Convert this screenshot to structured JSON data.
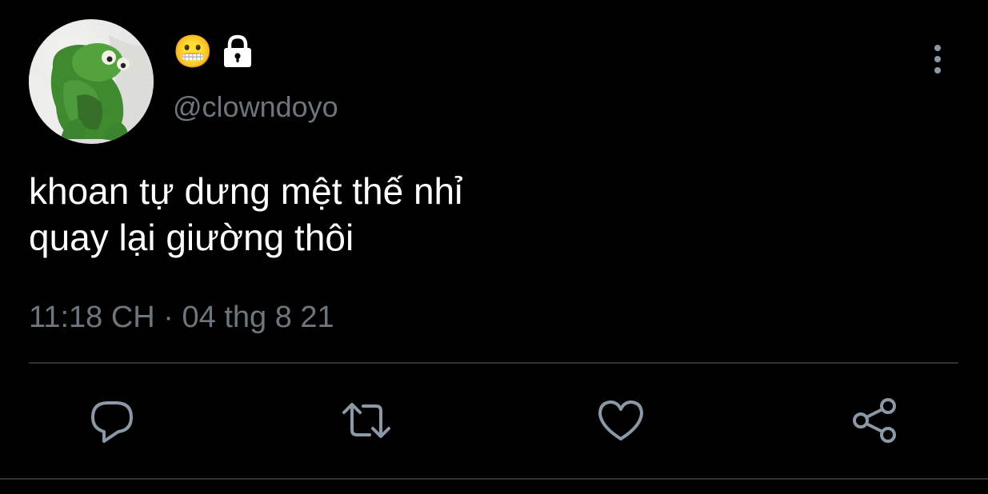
{
  "author": {
    "display_name": "😬",
    "handle": "@clowndoyo",
    "protected_icon": "lock-icon",
    "avatar": "kermit-avatar"
  },
  "tweet": {
    "lines": [
      "khoan tự dưng mệt thế nhỉ",
      "quay lại giường thôi"
    ],
    "time": "11:18 CH",
    "separator": "·",
    "date": "04 thg 8 21"
  },
  "actions": [
    {
      "icon": "reply-icon"
    },
    {
      "icon": "retweet-icon"
    },
    {
      "icon": "like-icon"
    },
    {
      "icon": "share-icon"
    }
  ],
  "colors": {
    "background": "#000000",
    "text": "#ffffff",
    "secondary": "#6e767d",
    "divider": "#2f3336",
    "icon": "#8b98a5"
  }
}
